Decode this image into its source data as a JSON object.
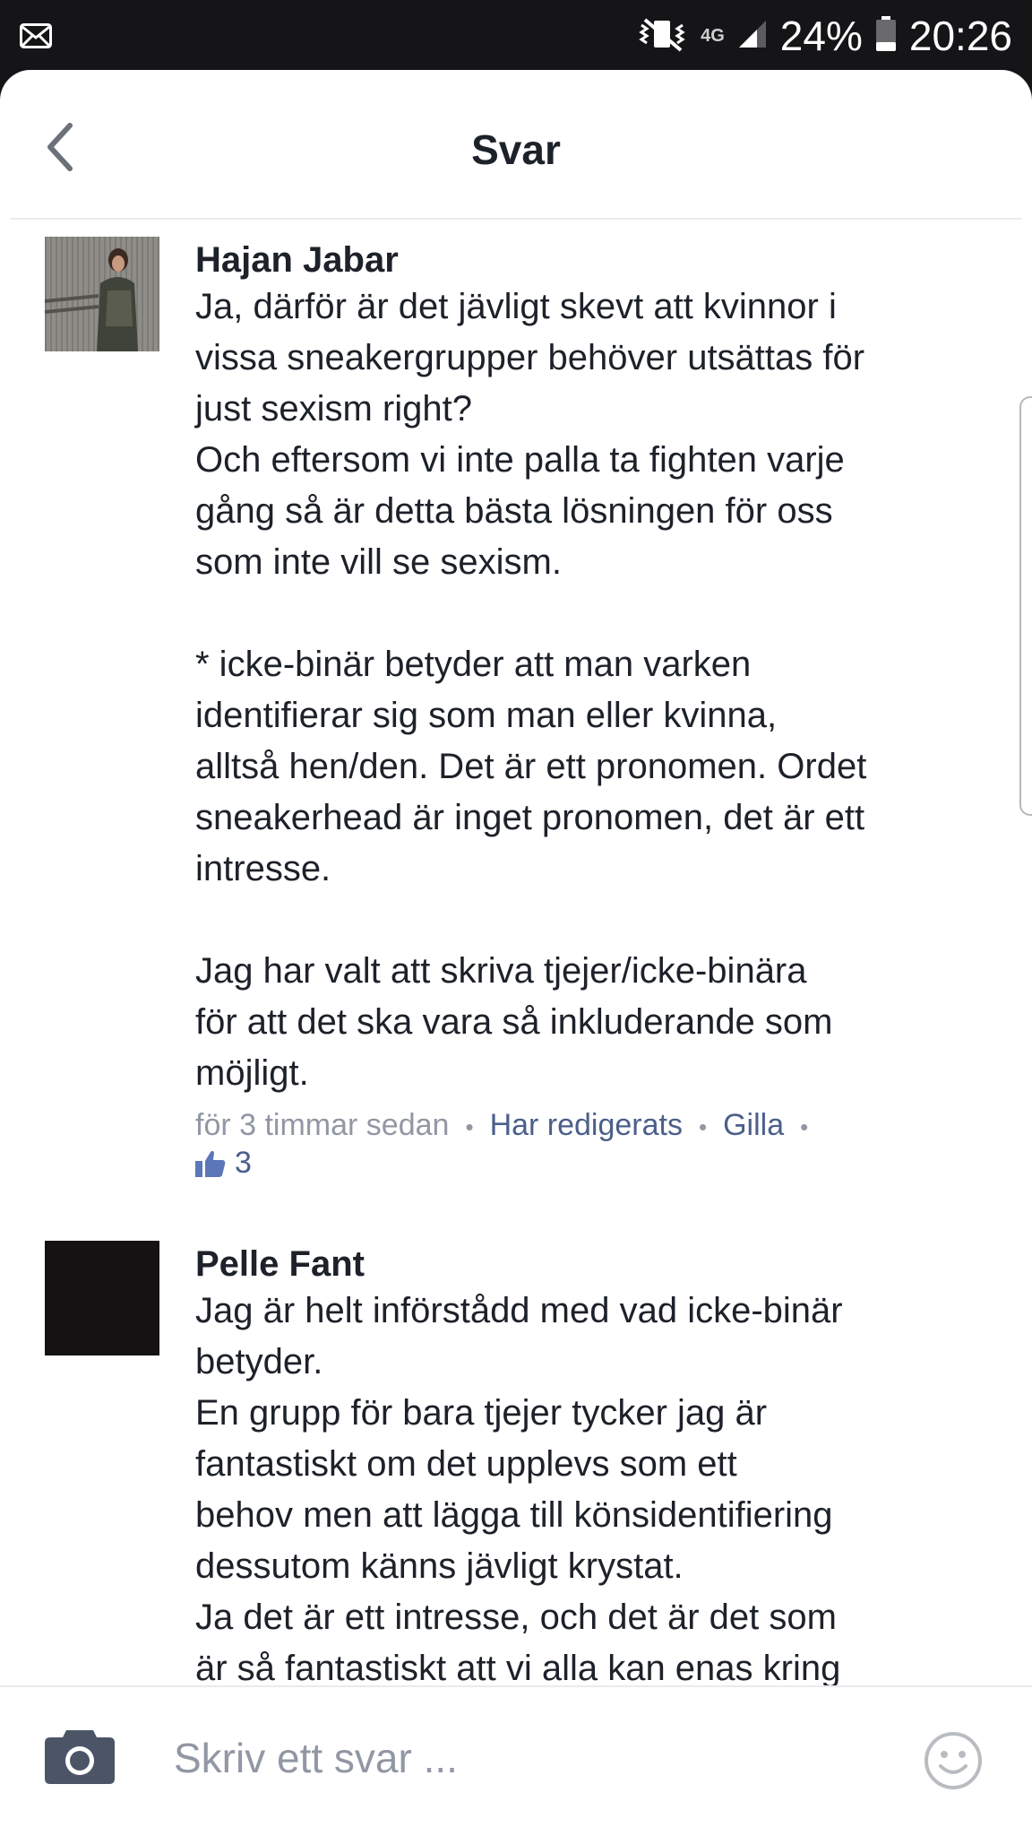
{
  "status_bar": {
    "network": "4G",
    "battery": "24%",
    "time": "20:26"
  },
  "header": {
    "title": "Svar"
  },
  "comments": [
    {
      "author": "Hajan Jabar",
      "text": "Ja, därför är det jävligt skevt att kvinnor i\nvissa sneakergrupper behöver utsättas för\njust sexism right?\nOch eftersom vi inte palla ta fighten varje\ngång så är detta bästa lösningen för oss\nsom inte vill se sexism.\n\n* icke-binär betyder att man varken\nidentifierar sig som man eller kvinna,\nalltså hen/den. Det är ett pronomen. Ordet\nsneakerhead är inget pronomen, det är ett\nintresse.\n\nJag har valt att skriva tjejer/icke-binära\nför att det ska vara så inkluderande som\nmöjligt.",
      "time": "för 3 timmar sedan",
      "edited": "Har redigerats",
      "like_label": "Gilla",
      "like_count": "3"
    },
    {
      "author": "Pelle Fant",
      "text": "Jag är helt införstådd med vad icke-binär\nbetyder.\nEn grupp för bara tjejer tycker jag är\nfantastiskt om det upplevs som ett\nbehov men att lägga till könsidentifiering\ndessutom känns jävligt krystat.\nJa det är ett intresse, och det är det som\när så fantastiskt att vi alla kan enas kring"
    }
  ],
  "composer": {
    "placeholder": "Skriv ett svar ..."
  }
}
